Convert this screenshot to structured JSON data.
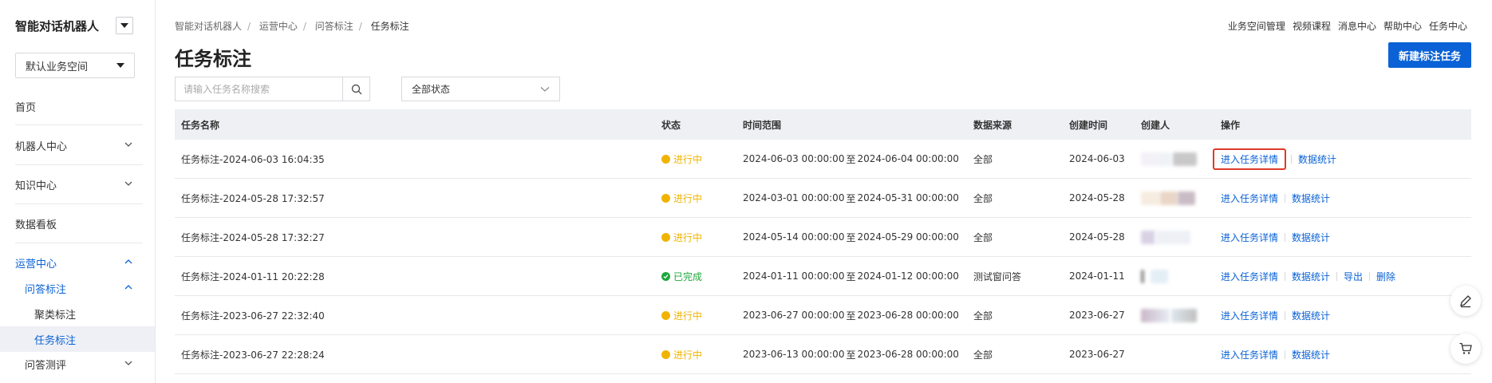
{
  "sidebar": {
    "app_title": "智能对话机器人",
    "workspace": "默认业务空间",
    "items": [
      {
        "label": "首页"
      },
      {
        "label": "机器人中心"
      },
      {
        "label": "知识中心"
      },
      {
        "label": "数据看板"
      },
      {
        "label": "运营中心"
      },
      {
        "label": "问答标注"
      },
      {
        "label": "聚类标注"
      },
      {
        "label": "任务标注"
      },
      {
        "label": "问答测评"
      }
    ]
  },
  "breadcrumb": [
    "智能对话机器人",
    "运营中心",
    "问答标注",
    "任务标注"
  ],
  "top_links": [
    "业务空间管理",
    "视频课程",
    "消息中心",
    "帮助中心",
    "任务中心"
  ],
  "page_title": "任务标注",
  "new_button": "新建标注任务",
  "search": {
    "placeholder": "请输入任务名称搜索",
    "value": ""
  },
  "status_filter": "全部状态",
  "table": {
    "headers": [
      "任务名称",
      "状态",
      "时间范围",
      "数据来源",
      "创建时间",
      "创建人",
      "操作"
    ],
    "range_sep": "至",
    "rows": [
      {
        "name": "任务标注-2024-06-03 16:04:35",
        "status": "进行中",
        "start": "2024-06-03 00:00:00",
        "end": "2024-06-04 00:00:00",
        "source": "全部",
        "created": "2024-06-03",
        "ops": [
          "进入任务详情",
          "数据统计"
        ]
      },
      {
        "name": "任务标注-2024-05-28 17:32:57",
        "status": "进行中",
        "start": "2024-03-01 00:00:00",
        "end": "2024-05-31 00:00:00",
        "source": "全部",
        "created": "2024-05-28",
        "ops": [
          "进入任务详情",
          "数据统计"
        ]
      },
      {
        "name": "任务标注-2024-05-28 17:32:27",
        "status": "进行中",
        "start": "2024-05-14 00:00:00",
        "end": "2024-05-29 00:00:00",
        "source": "全部",
        "created": "2024-05-28",
        "ops": [
          "进入任务详情",
          "数据统计"
        ]
      },
      {
        "name": "任务标注-2024-01-11 20:22:28",
        "status": "已完成",
        "start": "2024-01-11 00:00:00",
        "end": "2024-01-12 00:00:00",
        "source": "测试窗问答",
        "created": "2024-01-11",
        "ops": [
          "进入任务详情",
          "数据统计",
          "导出",
          "删除"
        ]
      },
      {
        "name": "任务标注-2023-06-27 22:32:40",
        "status": "进行中",
        "start": "2023-06-27 00:00:00",
        "end": "2023-06-28 00:00:00",
        "source": "全部",
        "created": "2023-06-27",
        "ops": [
          "进入任务详情",
          "数据统计"
        ]
      },
      {
        "name": "任务标注-2023-06-27 22:28:24",
        "status": "进行中",
        "start": "2023-06-13 00:00:00",
        "end": "2023-06-28 00:00:00",
        "source": "全部",
        "created": "2023-06-27",
        "ops": [
          "进入任务详情",
          "数据统计"
        ]
      }
    ]
  },
  "colors": {
    "primary": "#0a62d6",
    "running": "#f0b400",
    "done": "#1ea73c",
    "highlight": "#e03a28"
  },
  "icons": [
    "chevron-down-icon",
    "search-icon",
    "check-icon",
    "edit-icon",
    "cart-icon"
  ]
}
